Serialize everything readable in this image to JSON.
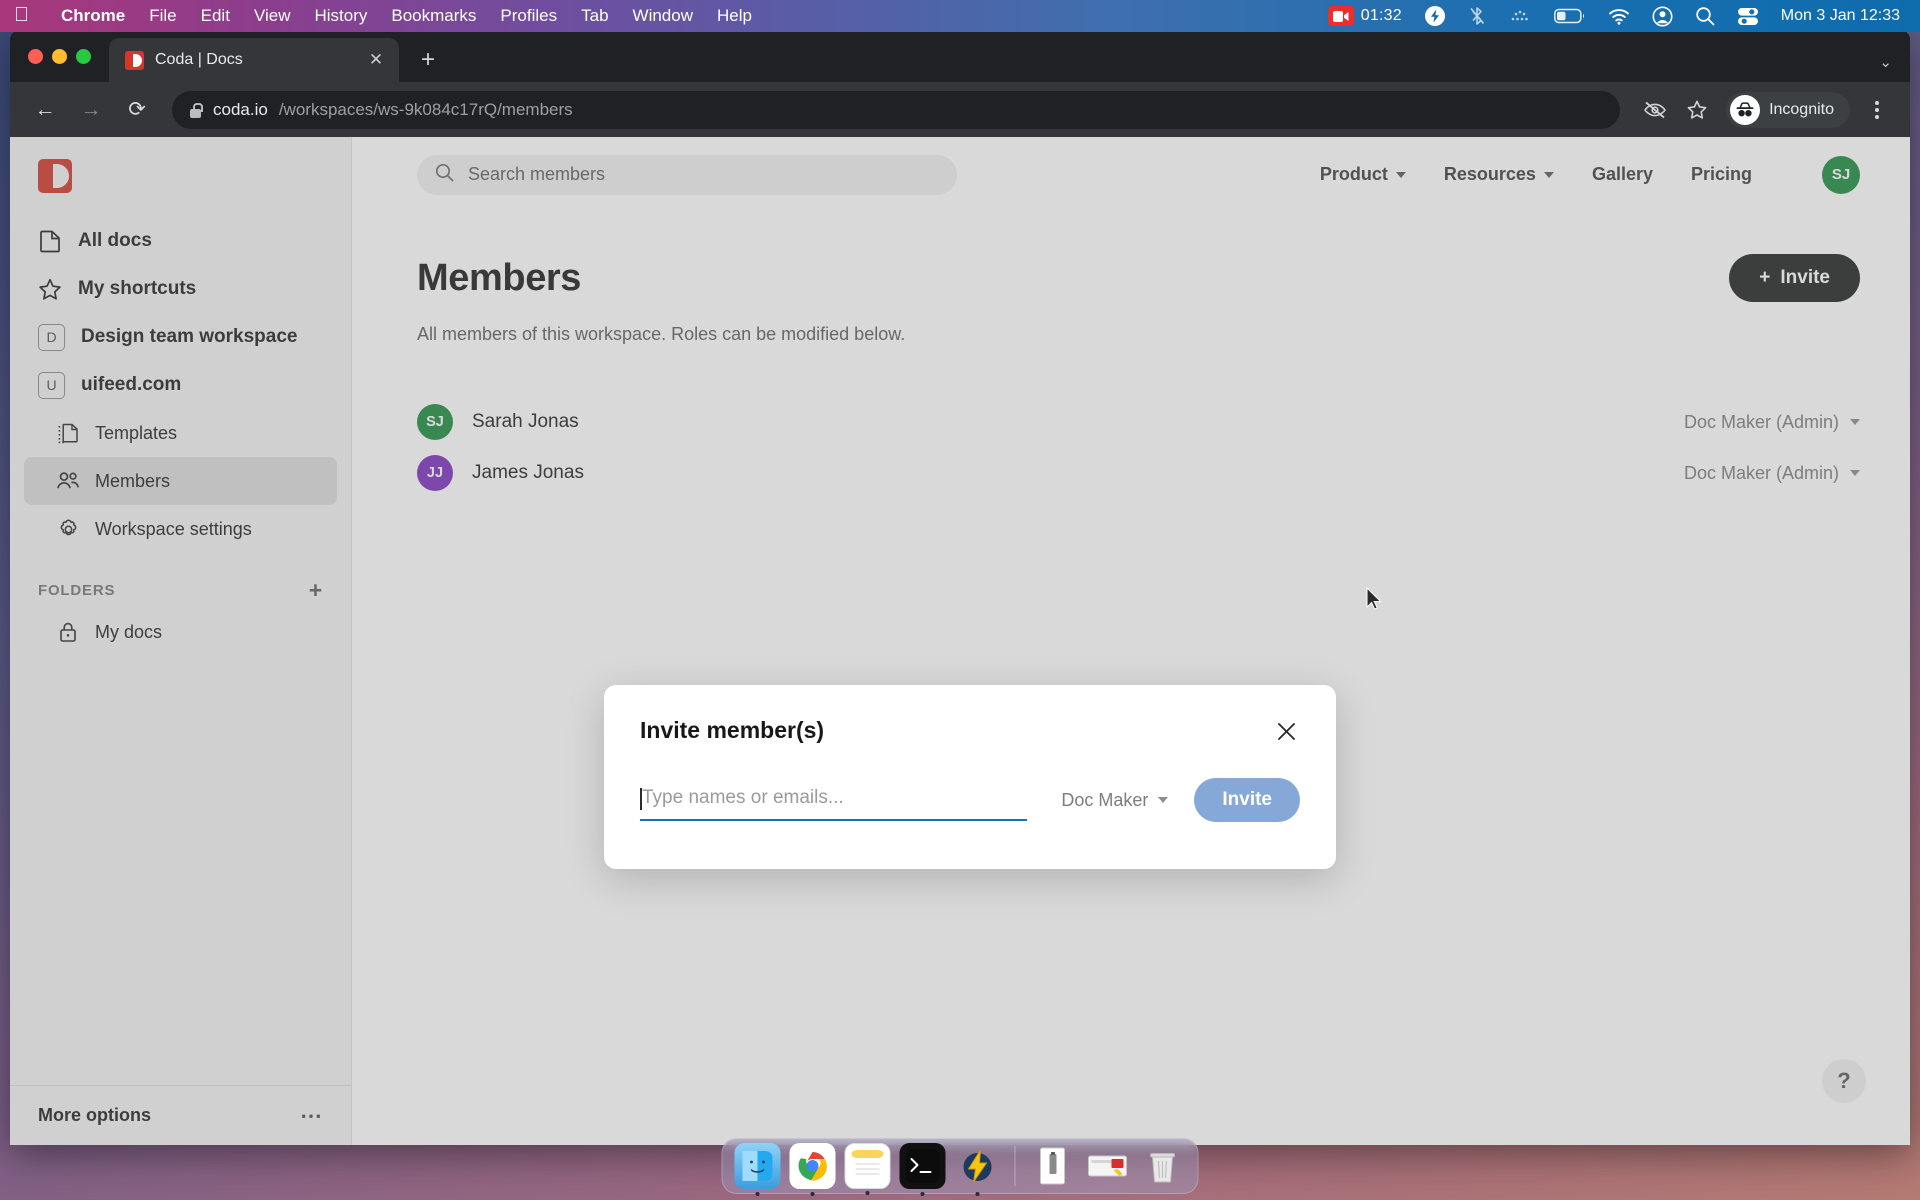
{
  "menubar": {
    "apple_icon": "apple-icon",
    "items": [
      {
        "label": "Chrome",
        "bold": true
      },
      {
        "label": "File",
        "bold": false
      },
      {
        "label": "Edit",
        "bold": false
      },
      {
        "label": "View",
        "bold": false
      },
      {
        "label": "History",
        "bold": false
      },
      {
        "label": "Bookmarks",
        "bold": false
      },
      {
        "label": "Profiles",
        "bold": false
      },
      {
        "label": "Tab",
        "bold": false
      },
      {
        "label": "Window",
        "bold": false
      },
      {
        "label": "Help",
        "bold": false
      }
    ],
    "recording_time": "01:32",
    "status_icons": [
      "screen-recording-icon",
      "bolt-icon",
      "bluetooth-off-icon",
      "keyboard-brightness-icon",
      "battery-icon",
      "wifi-icon",
      "control-center-user-icon",
      "spotlight-search-icon",
      "control-center-icon"
    ],
    "clock": "Mon 3 Jan  12:33"
  },
  "browser": {
    "tab": {
      "title": "Coda | Docs",
      "favicon": "coda-favicon",
      "close_label": "✕"
    },
    "new_tab_label": "+",
    "tabstrip_chevron": "⌄",
    "nav": {
      "back": "←",
      "forward": "→",
      "reload": "⟳"
    },
    "url": {
      "host": "coda.io",
      "path": "/workspaces/ws-9k084c17rQ/members"
    },
    "profile_label": "Incognito",
    "omnibox_icons": [
      "eye-slash-icon",
      "bookmark-star-icon"
    ]
  },
  "sidebar": {
    "logo": "coda-logo",
    "items": [
      {
        "label": "All docs",
        "icon": "document-icon",
        "badge": null,
        "active": false,
        "sub": false
      },
      {
        "label": "My shortcuts",
        "icon": "star-icon",
        "badge": null,
        "active": false,
        "sub": false
      },
      {
        "label": "Design team workspace",
        "icon": "workspace-badge",
        "badge": "D",
        "active": false,
        "sub": false
      },
      {
        "label": "uifeed.com",
        "icon": "workspace-badge",
        "badge": "U",
        "active": false,
        "sub": false
      },
      {
        "label": "Templates",
        "icon": "templates-icon",
        "badge": null,
        "active": false,
        "sub": true
      },
      {
        "label": "Members",
        "icon": "members-icon",
        "badge": null,
        "active": true,
        "sub": true
      },
      {
        "label": "Workspace settings",
        "icon": "gear-icon",
        "badge": null,
        "active": false,
        "sub": true
      }
    ],
    "folders_label": "FOLDERS",
    "folders_add": "+",
    "folders": [
      {
        "label": "My docs",
        "icon": "lock-icon"
      }
    ],
    "more_options_label": "More options",
    "more_options_icon": "ellipsis-icon"
  },
  "topnav": {
    "search_placeholder": "Search members",
    "search_icon": "search-icon",
    "links": [
      {
        "label": "Product",
        "has_caret": true
      },
      {
        "label": "Resources",
        "has_caret": true
      },
      {
        "label": "Gallery",
        "has_caret": false
      },
      {
        "label": "Pricing",
        "has_caret": false
      }
    ],
    "avatar": {
      "initials": "SJ",
      "color": "#1a8c3e"
    }
  },
  "main": {
    "title": "Members",
    "invite_button": {
      "label": "Invite",
      "plus": "+"
    },
    "subtitle": "All members of this workspace. Roles can be modified below.",
    "members": [
      {
        "initials": "SJ",
        "name": "Sarah Jonas",
        "role": "Doc Maker (Admin)",
        "color": "#1a8c3e"
      },
      {
        "initials": "JJ",
        "name": "James Jonas",
        "role": "Doc Maker (Admin)",
        "color": "#7b2fbe"
      }
    ],
    "help_label": "?"
  },
  "modal": {
    "title": "Invite member(s)",
    "close_icon": "close-icon",
    "input_placeholder": "Type names or emails...",
    "input_value": "",
    "role_label": "Doc Maker",
    "submit_label": "Invite"
  },
  "dock": {
    "apps": [
      {
        "name": "finder",
        "glyph": "🙂",
        "running": true
      },
      {
        "name": "chrome",
        "glyph": "◉",
        "running": true
      },
      {
        "name": "notes",
        "glyph": "📒",
        "running": true
      },
      {
        "name": "terminal",
        "glyph": "▸_",
        "running": true
      },
      {
        "name": "bolt-app",
        "glyph": "⚡",
        "running": true
      },
      {
        "name": "document-file",
        "glyph": "📄",
        "running": false
      },
      {
        "name": "screenshot-file",
        "glyph": "🖼",
        "running": false
      },
      {
        "name": "trash",
        "glyph": "🗑",
        "running": false
      }
    ]
  },
  "colors": {
    "accent_red": "#d2372a",
    "invite_blue": "#85a8d8",
    "input_underline": "#1a73b8",
    "green_avatar": "#1a8c3e",
    "purple_avatar": "#7b2fbe"
  }
}
